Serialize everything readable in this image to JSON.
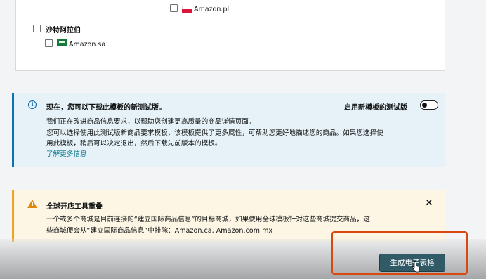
{
  "marketplaces": {
    "pl": {
      "label": "Amazon.pl"
    },
    "saudi": {
      "region_label": "沙特阿拉伯",
      "label": "Amazon.sa"
    }
  },
  "info_alert": {
    "title": "现在，您可以下载此模板的新测试版。",
    "toggle_label": "启用新模板的测试版",
    "toggle_on": false,
    "lines": [
      "我们正在改进商品信息要求，以帮助您创建更高质量的商品详情页面。",
      "您可以选择使用此测试版新商品要求模板，该模板提供了更多属性，可帮助您更好地描述您的商品。如果您选择使",
      "用此模板，稍后可以决定退出，然后下载先前版本的模板。"
    ],
    "link": "了解更多信息",
    "icon": "info-icon",
    "accent_color": "#0972b5"
  },
  "warning_alert": {
    "title": "全球开店工具重叠",
    "lines": [
      "一个或多个商城是目前连接的“建立国际商品信息”的目标商城，如果使用全球模板针对这些商城提交商品，这",
      "些商城便会从“建立国际商品信息”中排除：Amazon.ca, Amazon.com.mx"
    ],
    "close_glyph": "✕",
    "icon": "warning-icon",
    "accent_color": "#f0a21b"
  },
  "actions": {
    "generate_label": "生成电子表格"
  }
}
